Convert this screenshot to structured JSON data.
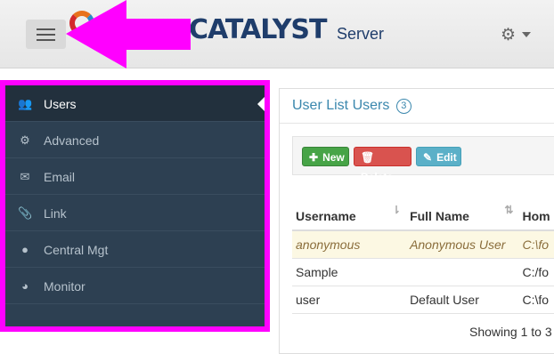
{
  "header": {
    "brand": "CATALYST",
    "subtitle": "Server",
    "settings_icon": "gear-icon",
    "menu_icon": "hamburger-icon"
  },
  "colors": {
    "annotation": "#ff00ff",
    "sidebar_bg": "#2d4052",
    "sidebar_active": "#22303d",
    "brand": "#1f3d6b",
    "link": "#3a87ad"
  },
  "sidebar": {
    "items": [
      {
        "label": "Users",
        "icon": "users-icon",
        "active": true
      },
      {
        "label": "Advanced",
        "icon": "cogs-icon",
        "active": false
      },
      {
        "label": "Email",
        "icon": "envelope-icon",
        "active": false
      },
      {
        "label": "Link",
        "icon": "paperclip-icon",
        "active": false
      },
      {
        "label": "Central Mgt",
        "icon": "globe-icon",
        "active": false
      },
      {
        "label": "Monitor",
        "icon": "pie-chart-icon",
        "active": false
      }
    ]
  },
  "main": {
    "title": "User List Users",
    "count": "3",
    "toolbar": {
      "new_label": "New",
      "delete_label": "Delete",
      "edit_label": "Edit"
    },
    "table": {
      "headers": [
        "Username",
        "Full Name",
        "Hom"
      ],
      "rows": [
        {
          "username": "anonymous",
          "full_name": "Anonymous User",
          "home": "C:\\fo",
          "selected": true
        },
        {
          "username": "Sample",
          "full_name": "",
          "home": "C:/fo",
          "selected": false
        },
        {
          "username": "user",
          "full_name": "Default User",
          "home": "C:\\fo",
          "selected": false
        }
      ]
    },
    "showing": "Showing 1 to 3"
  }
}
